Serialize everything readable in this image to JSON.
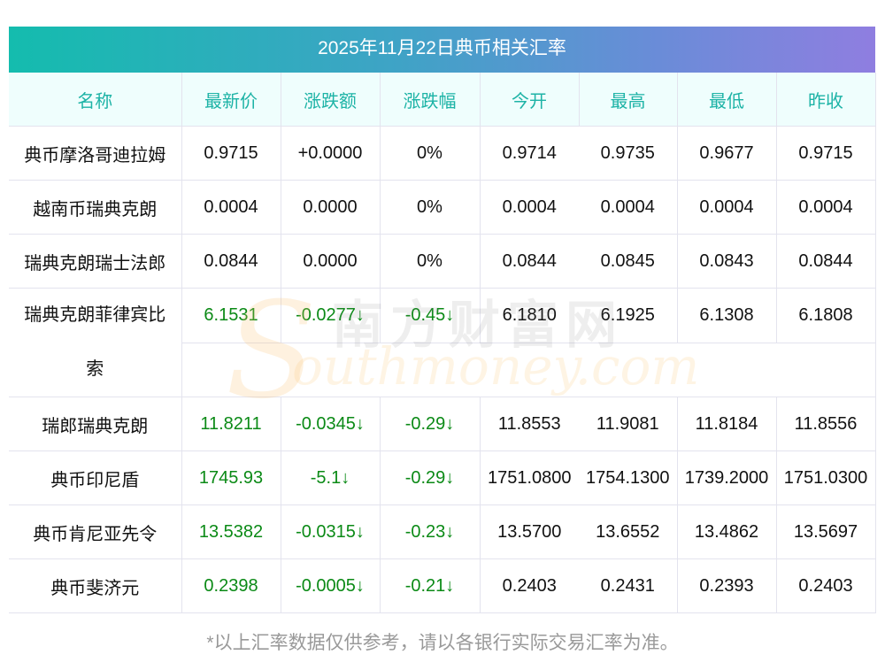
{
  "title": "2025年11月22日典币相关汇率",
  "headers": [
    "名称",
    "最新价",
    "涨跌额",
    "涨跌幅",
    "今开",
    "最高",
    "最低",
    "昨收"
  ],
  "rows": [
    {
      "name": "典币摩洛哥迪拉姆",
      "values": [
        "0.9715",
        "+0.0000",
        "0%",
        "0.9714",
        "0.9735",
        "0.9677",
        "0.9715"
      ],
      "trend": "flat"
    },
    {
      "name": "越南币瑞典克朗",
      "values": [
        "0.0004",
        "0.0000",
        "0%",
        "0.0004",
        "0.0004",
        "0.0004",
        "0.0004"
      ],
      "trend": "flat"
    },
    {
      "name": "瑞典克朗瑞士法郎",
      "values": [
        "0.0844",
        "0.0000",
        "0%",
        "0.0844",
        "0.0845",
        "0.0843",
        "0.0844"
      ],
      "trend": "flat"
    },
    {
      "name": "瑞典克朗菲律宾比索",
      "values": [
        "6.1531",
        "-0.0277↓",
        "-0.45↓",
        "6.1810",
        "6.1925",
        "6.1308",
        "6.1808"
      ],
      "trend": "down"
    },
    {
      "name": "瑞郎瑞典克朗",
      "values": [
        "11.8211",
        "-0.0345↓",
        "-0.29↓",
        "11.8553",
        "11.9081",
        "11.8184",
        "11.8556"
      ],
      "trend": "down"
    },
    {
      "name": "典币印尼盾",
      "values": [
        "1745.93",
        "-5.1↓",
        "-0.29↓",
        "1751.0800",
        "1754.1300",
        "1739.2000",
        "1751.0300"
      ],
      "trend": "down"
    },
    {
      "name": "典币肯尼亚先令",
      "values": [
        "13.5382",
        "-0.0315↓",
        "-0.23↓",
        "13.5700",
        "13.6552",
        "13.4862",
        "13.5697"
      ],
      "trend": "down"
    },
    {
      "name": "典币斐济元",
      "values": [
        "0.2398",
        "-0.0005↓",
        "-0.21↓",
        "0.2403",
        "0.2431",
        "0.2393",
        "0.2403"
      ],
      "trend": "down"
    }
  ],
  "watermark": {
    "cn": "南方财富网",
    "en": "outhmoney.com"
  },
  "footer": "*以上汇率数据仅供参考，请以各银行实际交易汇率为准。",
  "colors": {
    "down": "#0b8a16",
    "header_text": "#1db3a6",
    "header_bg": "#effefd"
  }
}
